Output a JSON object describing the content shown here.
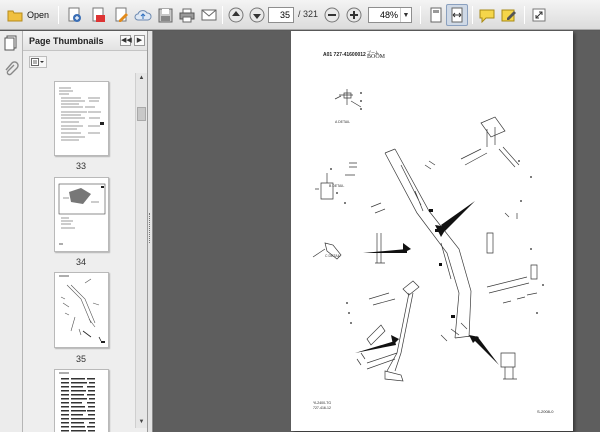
{
  "toolbar": {
    "open_label": "Open",
    "current_page": "35",
    "total_pages": "/ 321",
    "zoom": "48%"
  },
  "thumbnails": {
    "title": "Page Thumbnails",
    "pages": [
      {
        "number": "33"
      },
      {
        "number": "34"
      },
      {
        "number": "35"
      }
    ]
  },
  "document": {
    "header_code": "A01     727-41600012",
    "header_jp": "ブーム",
    "header_en": "BOOM",
    "detail_a": "A DETAIL",
    "detail_b": "B DETAIL",
    "detail_c": "C DETAIL",
    "footer_line1": "YL2400-TG",
    "footer_line2": "727-416-12",
    "footer_right": "S-2008-0"
  },
  "colors": {
    "toolbar_bg": "#e6e6e6",
    "doc_bg": "#5e5e5e",
    "accent_blue": "#3b6fb6",
    "folder_yellow": "#f0c040"
  }
}
